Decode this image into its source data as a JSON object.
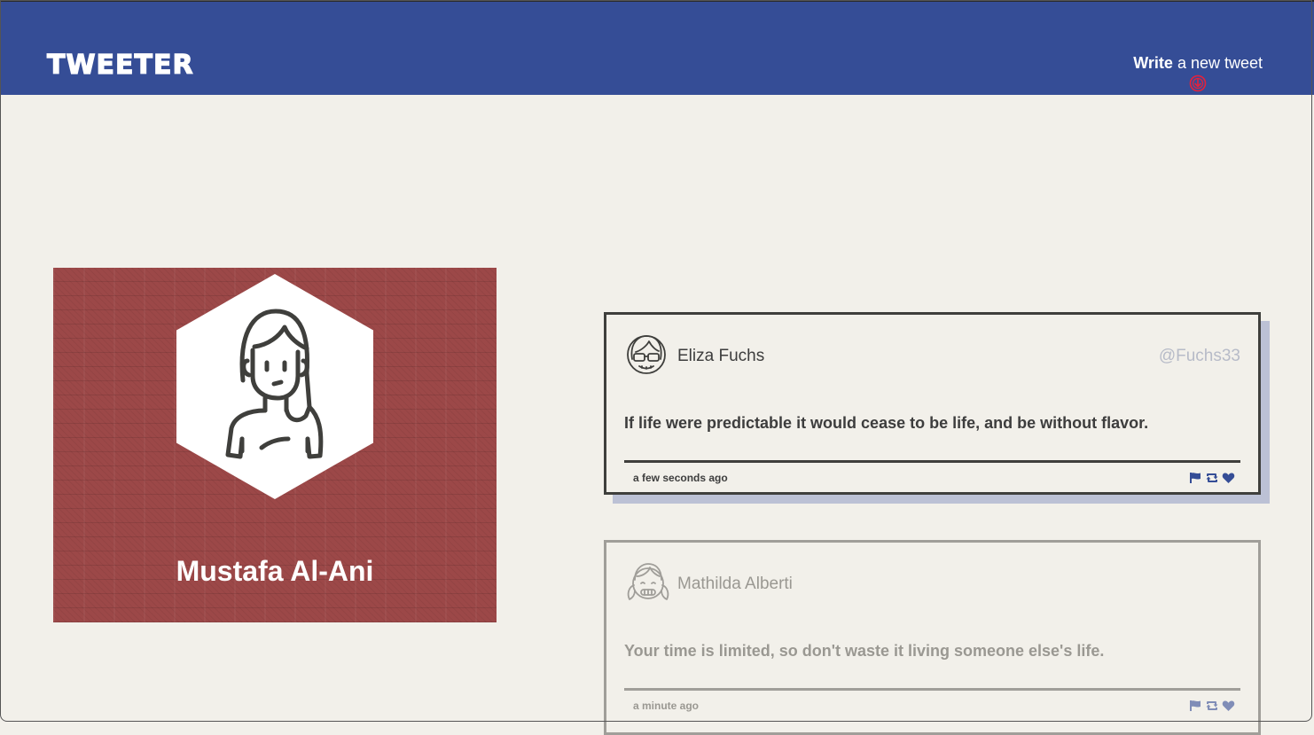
{
  "nav": {
    "brand": "TWEETER",
    "compose_bold": "Write",
    "compose_rest": " a new tweet",
    "compose_icon": "arrow-down-circle-icon",
    "colors": {
      "bar": "#354d96",
      "icon": "#e5213b"
    }
  },
  "profile": {
    "name": "Mustafa Al-Ani",
    "background_color": "#9c4848",
    "avatar_icon": "woman-avatar-icon"
  },
  "tweets": [
    {
      "name": "Eliza Fuchs",
      "handle": "@Fuchs33",
      "text": "If life were predictable it would cease to be life, and be without flavor.",
      "time": "a few seconds ago",
      "avatar_icon": "girl-glasses-avatar-icon",
      "actions": [
        "flag-icon",
        "retweet-icon",
        "heart-icon"
      ]
    },
    {
      "name": "Mathilda Alberti",
      "handle": "",
      "text": "Your time is limited, so don't waste it living someone else's life.",
      "time": "a minute ago",
      "avatar_icon": "girl-pigtails-avatar-icon",
      "actions": [
        "flag-icon",
        "retweet-icon",
        "heart-icon"
      ]
    }
  ]
}
